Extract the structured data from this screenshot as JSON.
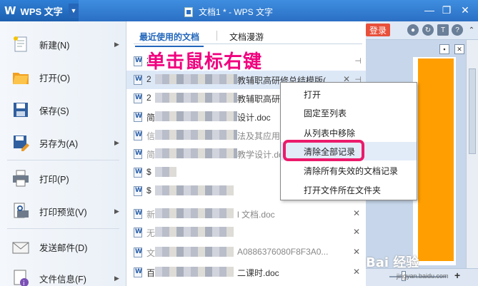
{
  "titlebar": {
    "app_name": "WPS 文字",
    "window_title": "文档1 * - WPS 文字",
    "minimize": "—",
    "maximize": "❐",
    "close": "✕"
  },
  "ribbon": {
    "login": "登录"
  },
  "left_menu": [
    {
      "label": "新建(N)",
      "icon": "new-doc-icon",
      "arrow": true
    },
    {
      "label": "打开(O)",
      "icon": "open-folder-icon",
      "arrow": false
    },
    {
      "label": "保存(S)",
      "icon": "save-icon",
      "arrow": false
    },
    {
      "label": "另存为(A)",
      "icon": "save-as-icon",
      "arrow": true
    },
    {
      "label": "打印(P)",
      "icon": "printer-icon",
      "arrow": false
    },
    {
      "label": "打印预览(V)",
      "icon": "print-preview-icon",
      "arrow": true
    },
    {
      "label": "发送邮件(D)",
      "icon": "mail-icon",
      "arrow": false
    },
    {
      "label": "文件信息(F)",
      "icon": "file-info-icon",
      "arrow": true
    }
  ],
  "recent_panel": {
    "tabs": [
      "最近使用的文档",
      "文档漫游"
    ],
    "rows": [
      {
        "first": "2",
        "name": "",
        "action": "pin"
      },
      {
        "first": "2",
        "name": "教辅职高研修总结模版(...",
        "action": "x-pin"
      },
      {
        "first": "2",
        "name": "教辅职高研修",
        "action": ""
      },
      {
        "first": "简",
        "name": "设计.doc",
        "action": ""
      },
      {
        "first": "信",
        "name": "法及其应用",
        "action": ""
      },
      {
        "first": "简",
        "name": "教学设计.doc",
        "action": ""
      },
      {
        "first": "$",
        "name": "",
        "action": ""
      },
      {
        "first": "$",
        "name": "",
        "action": ""
      },
      {
        "first": "新",
        "name": "l 文档.doc",
        "action": "x"
      },
      {
        "first": "无",
        "name": "",
        "action": "x"
      },
      {
        "first": "文",
        "name": "A0886376080F8F3A0...",
        "action": "x"
      },
      {
        "first": "百",
        "name": "二课时.doc",
        "action": "x"
      }
    ]
  },
  "annotation": "单击鼠标右键",
  "context_menu": [
    "打开",
    "固定至列表",
    "从列表中移除",
    "清除全部记录",
    "清除所有失效的文档记录",
    "打开文件所在文件夹"
  ],
  "watermark": {
    "logo": "Bai 经验",
    "url": "jingyan.baidu.com"
  },
  "colors": {
    "titlebar": "#2a6fc4",
    "accent_tab": "#2266bb",
    "annotation": "#f0007e",
    "highlight": "#ec1a6a",
    "document_fill": "#ff9e00",
    "login": "#e8503a"
  }
}
